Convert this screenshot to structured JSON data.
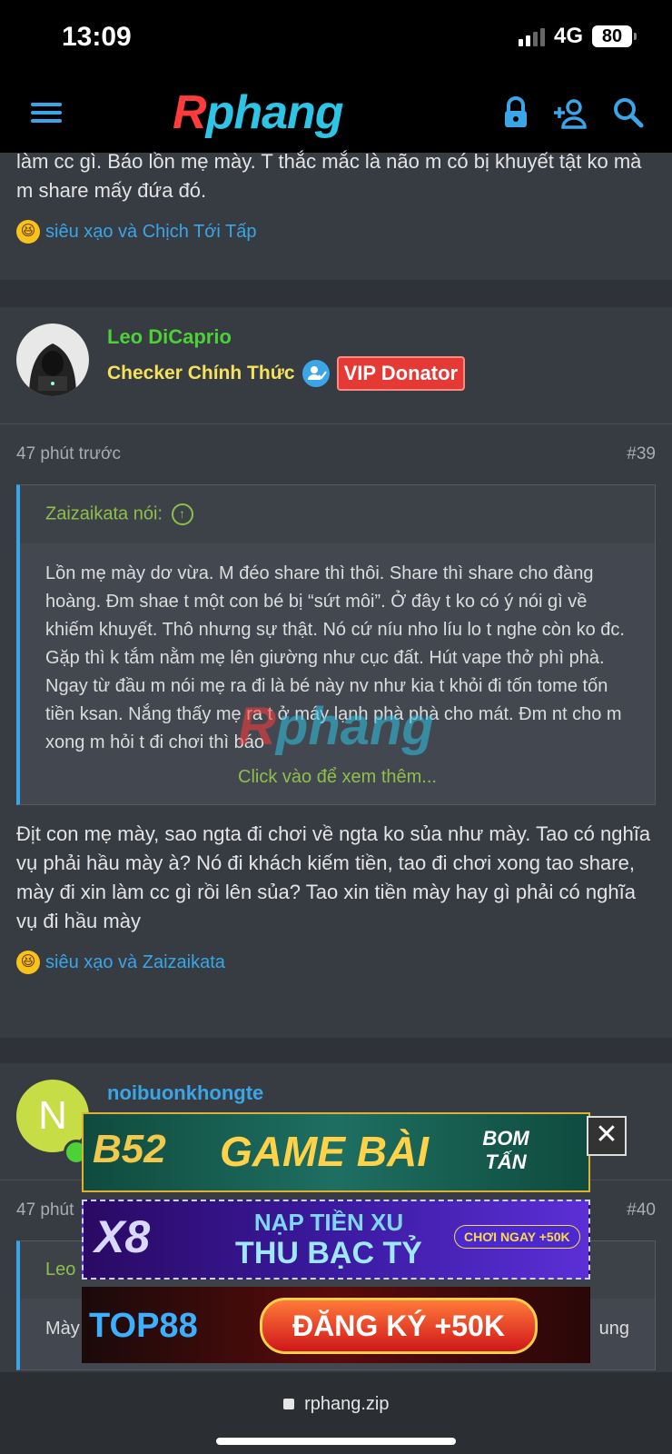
{
  "status": {
    "time": "13:09",
    "network": "4G",
    "battery": "80"
  },
  "nav": {
    "logo_r": "R",
    "logo_rest": "phang"
  },
  "top_post": {
    "text": "làm cc gì. Báo lồn mẹ mày. T thắc mắc là não m có bị khuyết tật ko mà m share mấy đứa đó.",
    "reactions": "siêu xạo và Chịch Tới Tấp"
  },
  "post39": {
    "author": "Leo DiCaprio",
    "user_title": "Checker Chính Thức",
    "badge": "VIP Donator",
    "time": "47 phút trước",
    "number": "#39",
    "quote_author": "Zaizaikata nói:",
    "quote_text": "Lồn mẹ mày dơ vừa. M đéo share thì thôi. Share thì share cho đàng hoàng. Đm shae t một con bé bị “sứt môi”. Ở đây t ko có ý nói gì về khiếm khuyết. Thô nhưng sự thật. Nó cứ níu nho líu lo t nghe còn ko đc. Gặp thì k tắm nằm mẹ lên giường như cục đất. Hút vape thở phì phà. Ngay từ đầu m nói mẹ ra đi là bé này nv như kia t khỏi đi tốn tome tốn tiền ksan. Nắng thấy mẹ ra t ở máy lạnh phà phà cho mát. Đm nt cho m xong m hỏi t đi chơi thì báo",
    "quote_more": "Click vào để xem thêm...",
    "body": "Địt con mẹ mày, sao ngta đi chơi về ngta ko sủa như mày. Tao có nghĩa vụ phải hầu mày à? Nó đi khách kiếm tiền, tao đi chơi xong tao share, mày đi xin làm cc gì rồi lên sủa? Tao xin tiền mày hay gì phải có nghĩa vụ đi hầu mày",
    "reactions": "siêu xạo và Zaizaikata"
  },
  "post40": {
    "author": "noibuonkhongte",
    "avatar_letter": "N",
    "time": "47 phút",
    "number": "#40",
    "quote_author": "Leo Di",
    "quote_text_start": "Mày",
    "quote_text_end": "ung"
  },
  "ads": [
    {
      "brand": "B52",
      "title": "GAME BÀI",
      "tag": "BOM TẤN"
    },
    {
      "brand": "X8",
      "title_top": "NẠP TIỀN XU",
      "title_bottom": "THU BẠC TỶ",
      "tag": "CHƠI NGAY +50K"
    },
    {
      "brand": "TOP88",
      "title": "ĐĂNG KÝ +50K"
    }
  ],
  "close_label": "✕",
  "browser": {
    "url": "rphang.zip"
  },
  "colors": {
    "accent": "#3aa6e8",
    "quote_green": "#8fbf4a",
    "author_green": "#4cd137",
    "title_yellow": "#f5e15a",
    "vip_red": "#e53935"
  }
}
